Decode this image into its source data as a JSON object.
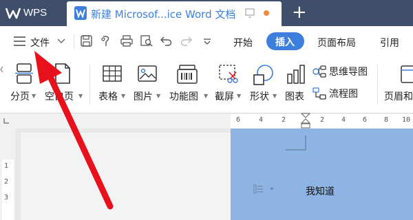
{
  "titlebar": {
    "app_name": "WPS",
    "doc_tab_title": "新建 Microsof...ice Word 文档",
    "new_tab_symbol": "+"
  },
  "menubar": {
    "file_label": "文件",
    "tabs": [
      "开始",
      "插入",
      "页面布局",
      "引用"
    ],
    "active_tab": "插入"
  },
  "ribbon": {
    "page_break": "分页",
    "blank_page": "空白页",
    "table": "表格",
    "picture": "图片",
    "function_chart": "功能图",
    "screenshot": "截屏",
    "shape": "形状",
    "chart": "图表",
    "mind_map": "思维导图",
    "flowchart": "流程图",
    "header_footer": "页眉和"
  },
  "ruler": {
    "h_labels": [
      "6",
      "4",
      "2",
      "2",
      "4",
      "6",
      "8",
      "10"
    ],
    "v_labels": [
      "1",
      "2",
      "3"
    ]
  },
  "document": {
    "body_text": "我知道"
  },
  "colors": {
    "titlebar": "#3f4e6a",
    "accent": "#3c7fdc",
    "page_fill": "#8eb4e3",
    "arrow": "#e8101a"
  }
}
